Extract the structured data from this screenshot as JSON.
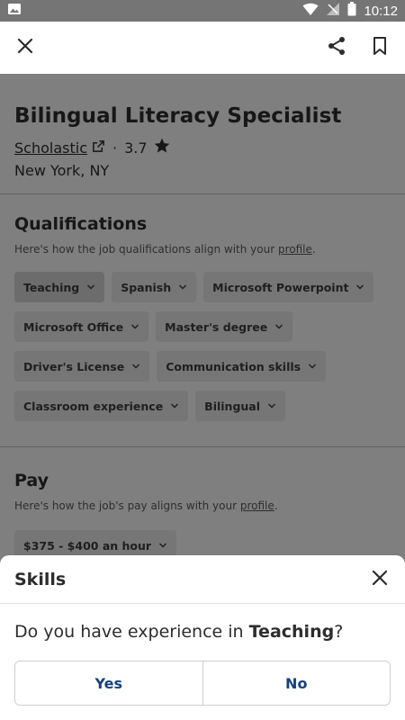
{
  "status_bar": {
    "time": "10:12"
  },
  "header": {
    "close_icon": "close-icon",
    "share_icon": "share-icon",
    "bookmark_icon": "bookmark-icon"
  },
  "job": {
    "title": "Bilingual Literacy Specialist",
    "company": "Scholastic",
    "separator": "·",
    "rating": "3.7",
    "location": "New York, NY"
  },
  "qualifications": {
    "heading": "Qualifications",
    "subtitle_prefix": "Here's how the job qualifications align with your ",
    "subtitle_link": "profile",
    "subtitle_suffix": ".",
    "chips": [
      {
        "label": "Teaching"
      },
      {
        "label": "Spanish"
      },
      {
        "label": "Microsoft Powerpoint"
      },
      {
        "label": "Microsoft Office"
      },
      {
        "label": "Master's degree"
      },
      {
        "label": "Driver's License"
      },
      {
        "label": "Communication skills"
      },
      {
        "label": "Classroom experience"
      },
      {
        "label": "Bilingual"
      }
    ]
  },
  "pay": {
    "heading": "Pay",
    "subtitle_prefix": "Here's how the job's pay aligns with your ",
    "subtitle_link": "profile",
    "subtitle_suffix": ".",
    "chip": "$375 - $400 an hour"
  },
  "sheet": {
    "title": "Skills",
    "question_prefix": "Do you have experience in ",
    "question_skill": "Teaching",
    "question_suffix": "?",
    "yes_label": "Yes",
    "no_label": "No"
  },
  "colors": {
    "accent": "#164081",
    "overlay": "#000000"
  }
}
